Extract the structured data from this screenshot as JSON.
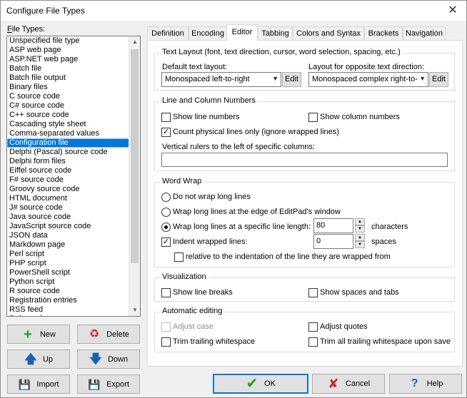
{
  "window": {
    "title": "Configure File Types",
    "close_glyph": "✕"
  },
  "file_types": {
    "label": "File Types:",
    "selected_index": 11,
    "items": [
      "Unspecified file type",
      "ASP web page",
      "ASP.NET web page",
      "Batch file",
      "Batch file output",
      "Binary files",
      "C source code",
      "C# source code",
      "C++ source code",
      "Cascading style sheet",
      "Comma-separated values",
      "Configuration file",
      "Delphi (Pascal) source code",
      "Delphi form files",
      "Eiffel source code",
      "F# source code",
      "Groovy source code",
      "HTML document",
      "J# source code",
      "Java source code",
      "JavaScript source code",
      "JSON data",
      "Markdown page",
      "Perl script",
      "PHP script",
      "PowerShell script",
      "Python script",
      "R source code",
      "Registration entries",
      "RSS feed",
      "Ruby script"
    ]
  },
  "left_buttons": {
    "new": "New",
    "delete": "Delete",
    "up": "Up",
    "down": "Down",
    "import": "Import",
    "export": "Export"
  },
  "tabs": [
    "Definition",
    "Encoding",
    "Editor",
    "Tabbing",
    "Colors and Syntax",
    "Brackets",
    "Navigation"
  ],
  "active_tab": "Editor",
  "text_layout": {
    "title": "Text Layout (font, text direction, cursor, word selection, spacing, etc.)",
    "default_label": "Default text layout:",
    "default_value": "Monospaced left-to-right",
    "opposite_label": "Layout for opposite text direction:",
    "opposite_value": "Monospaced complex right-to-",
    "edit": "Edit"
  },
  "line_numbers": {
    "title": "Line and Column Numbers",
    "show_line_numbers": "Show line numbers",
    "show_column_numbers": "Show column numbers",
    "count_physical": "Count physical lines only (ignore wrapped lines)",
    "rulers_label": "Vertical rulers to the left of specific columns:",
    "rulers_value": ""
  },
  "word_wrap": {
    "title": "Word Wrap",
    "no_wrap": "Do not wrap long lines",
    "wrap_edge": "Wrap long lines at the edge of EditPad's window",
    "wrap_length": "Wrap long lines at a specific line length:",
    "length_value": "80",
    "characters": "characters",
    "indent": "Indent wrapped lines:",
    "indent_value": "0",
    "spaces": "spaces",
    "relative": "relative to the indentation of the line they are wrapped from"
  },
  "visualization": {
    "title": "Visualization",
    "line_breaks": "Show line breaks",
    "spaces_tabs": "Show spaces and tabs"
  },
  "auto_editing": {
    "title": "Automatic editing",
    "adjust_case": "Adjust case",
    "adjust_quotes": "Adjust quotes",
    "trim_trailing": "Trim trailing whitespace",
    "trim_all": "Trim all trailing whitespace upon save"
  },
  "dialog_buttons": {
    "ok": "OK",
    "cancel": "Cancel",
    "help": "Help"
  },
  "colors": {
    "selection": "#0078d7",
    "ok_check": "#1e9e1e",
    "cancel_x": "#c0282a",
    "arrow_blue": "#1a5fb4",
    "new_plus": "#2a9d2a"
  }
}
